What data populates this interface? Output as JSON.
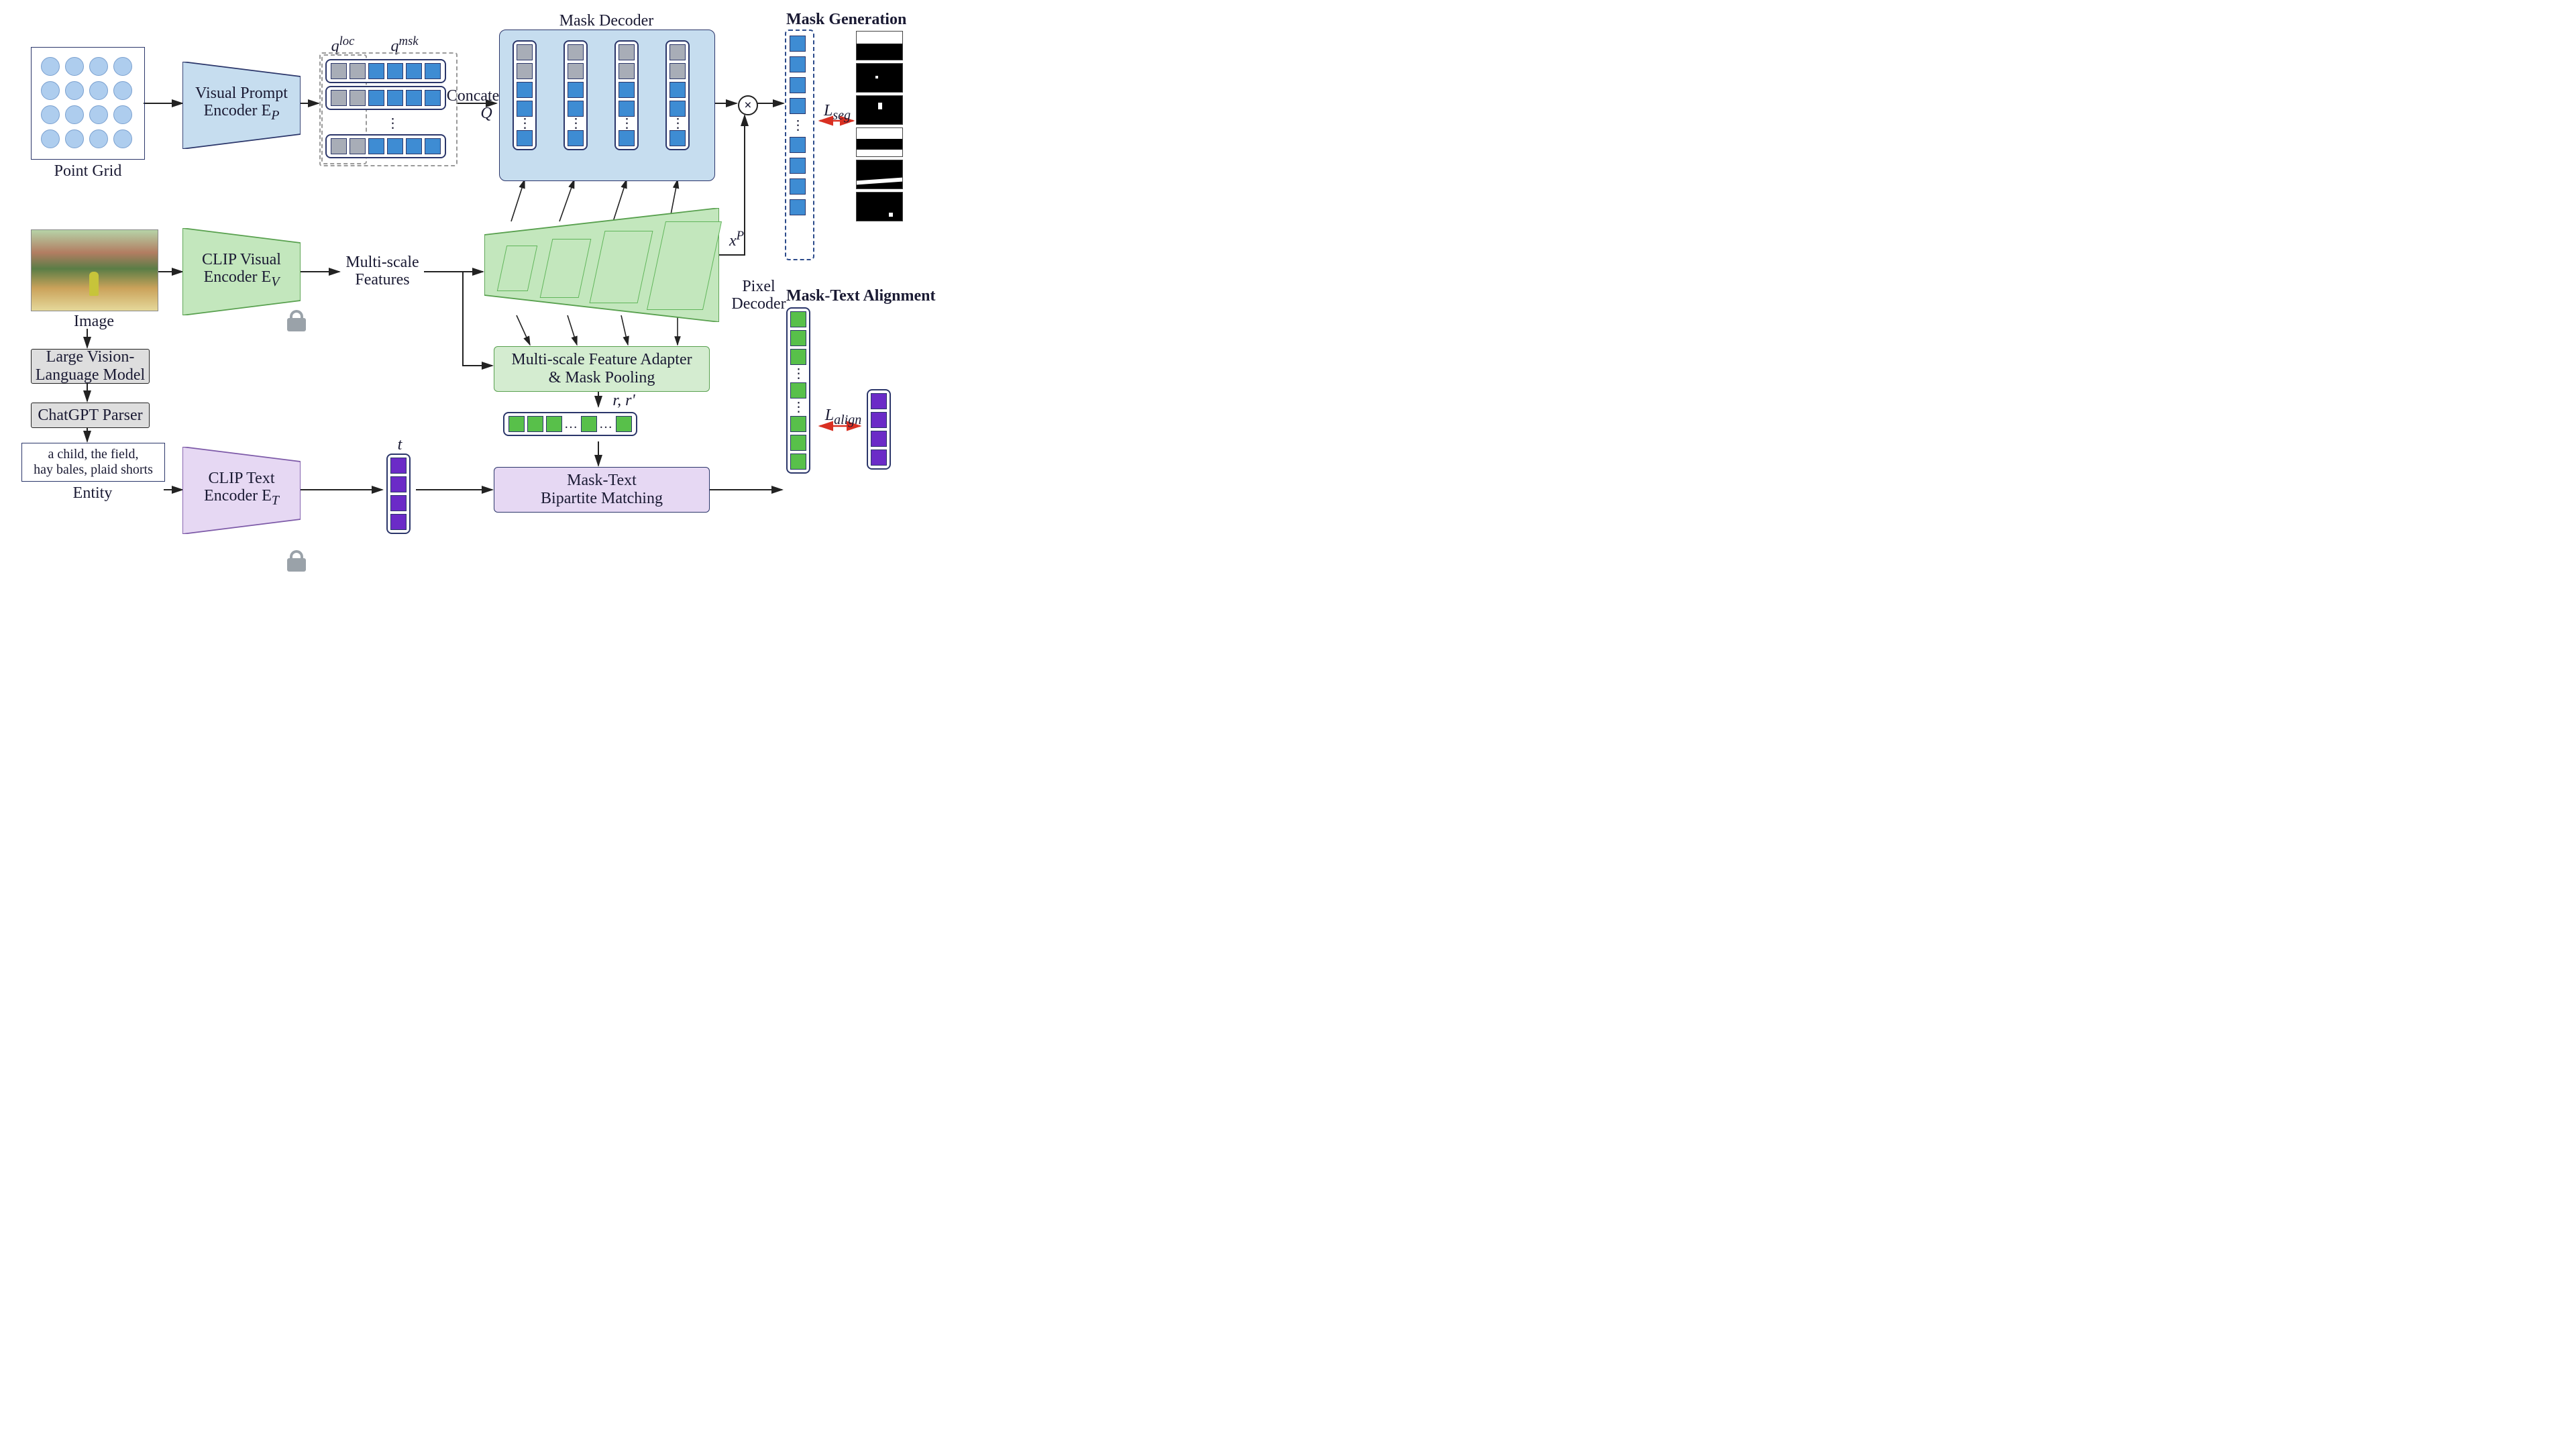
{
  "titles": {
    "mask_generation": "Mask Generation",
    "mask_text_align": "Mask-Text Alignment"
  },
  "inputs": {
    "point_grid": "Point Grid",
    "image": "Image",
    "entity_caption": "Entity",
    "entity_text": "a child, the field,\nhay bales, plaid shorts"
  },
  "modules": {
    "visual_prompt_encoder": "Visual Prompt\nEncoder E",
    "visual_prompt_encoder_sub": "P",
    "clip_visual_encoder": "CLIP Visual\nEncoder E",
    "clip_visual_encoder_sub": "V",
    "clip_text_encoder": "CLIP Text\nEncoder E",
    "clip_text_encoder_sub": "T",
    "lvlm": "Large Vision-\nLanguage Model",
    "chatgpt": "ChatGPT Parser",
    "mask_decoder": "Mask Decoder",
    "pixel_decoder": "Pixel\nDecoder",
    "ms_features": "Multi-scale\nFeatures",
    "ms_adapter": "Multi-scale Feature Adapter\n& Mask Pooling",
    "bipartite": "Mask-Text\nBipartite Matching"
  },
  "symbols": {
    "q_loc": "q",
    "q_loc_sup": "loc",
    "q_msk": "q",
    "q_msk_sup": "msk",
    "concat": "Concatenate",
    "Q": "Q",
    "t": "t",
    "rr": "r, r'",
    "xP": "x",
    "xP_sup": "P",
    "L_seg": "L",
    "L_seg_sub": "seg",
    "L_align": "L",
    "L_align_sub": "align"
  }
}
